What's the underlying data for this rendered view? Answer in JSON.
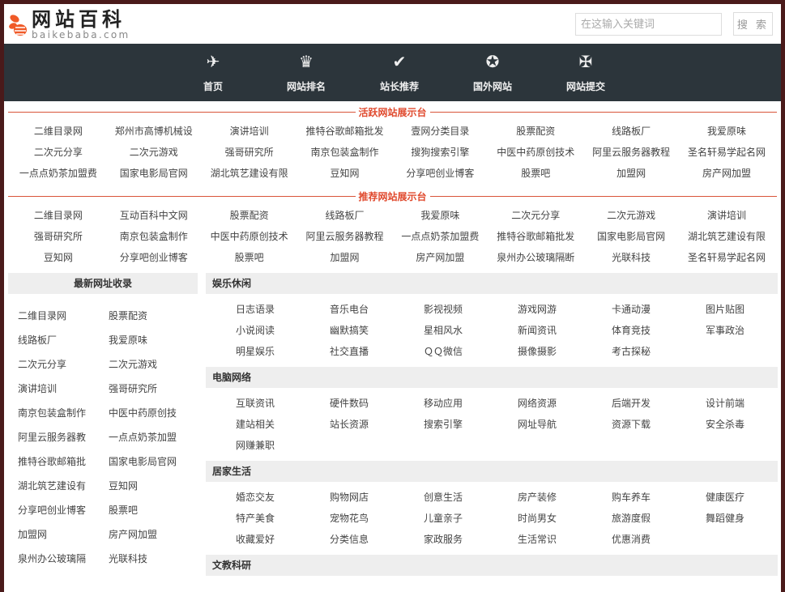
{
  "header": {
    "logo_title": "网站百科",
    "logo_sub": "baikebaba.com",
    "search_placeholder": "在这输入关键词",
    "search_button": "搜 索"
  },
  "colors": {
    "accent": "#e04a2e",
    "nav_bg": "#2c353b",
    "frame": "#4a1a1a",
    "section_bg": "#eeeeee"
  },
  "nav": [
    {
      "label": "首页",
      "icon": "plane-icon",
      "glyph": "✈"
    },
    {
      "label": "网站排名",
      "icon": "crown-icon",
      "glyph": "♛"
    },
    {
      "label": "站长推荐",
      "icon": "check-icon",
      "glyph": "✔"
    },
    {
      "label": "国外网站",
      "icon": "star-circle-icon",
      "glyph": "✪"
    },
    {
      "label": "网站提交",
      "icon": "maltese-cross-icon",
      "glyph": "✠"
    }
  ],
  "active_sites": {
    "title": "活跃网站展示台",
    "links": [
      "二维目录网",
      "郑州市高博机械设",
      "演讲培训",
      "推特谷歌邮箱批发",
      "壹网分类目录",
      "股票配资",
      "线路板厂",
      "我爱原味",
      "二次元分享",
      "二次元游戏",
      "强哥研究所",
      "南京包装盒制作",
      "搜狗搜索引擎",
      "中医中药原创技术",
      "阿里云服务器教程",
      "圣名轩易学起名网",
      "一点点奶茶加盟费",
      "国家电影局官网",
      "湖北筑艺建设有限",
      "豆知网",
      "分享吧创业博客",
      "股票吧",
      "加盟网",
      "房产网加盟"
    ]
  },
  "recommended_sites": {
    "title": "推荐网站展示台",
    "links": [
      "二维目录网",
      "互动百科中文网",
      "股票配资",
      "线路板厂",
      "我爱原味",
      "二次元分享",
      "二次元游戏",
      "演讲培训",
      "强哥研究所",
      "南京包装盒制作",
      "中医中药原创技术",
      "阿里云服务器教程",
      "一点点奶茶加盟费",
      "推特谷歌邮箱批发",
      "国家电影局官网",
      "湖北筑艺建设有限",
      "豆知网",
      "分享吧创业博客",
      "股票吧",
      "加盟网",
      "房产网加盟",
      "泉州办公玻璃隔断",
      "光联科技",
      "圣名轩易学起名网"
    ]
  },
  "latest": {
    "title": "最新网址收录",
    "links": [
      "二维目录网",
      "股票配资",
      "线路板厂",
      "我爱原味",
      "二次元分享",
      "二次元游戏",
      "演讲培训",
      "强哥研究所",
      "南京包装盒制作",
      "中医中药原创技",
      "阿里云服务器教",
      "一点点奶茶加盟",
      "推特谷歌邮箱批",
      "国家电影局官网",
      "湖北筑艺建设有",
      "豆知网",
      "分享吧创业博客",
      "股票吧",
      "加盟网",
      "房产网加盟",
      "泉州办公玻璃隔",
      "光联科技"
    ]
  },
  "categories": [
    {
      "title": "娱乐休闲",
      "links": [
        "日志语录",
        "音乐电台",
        "影视视频",
        "游戏网游",
        "卡通动漫",
        "图片贴图",
        "小说阅读",
        "幽默搞笑",
        "星相风水",
        "新闻资讯",
        "体育竞技",
        "军事政治",
        "明星娱乐",
        "社交直播",
        "ＱＱ微信",
        "摄像摄影",
        "考古探秘"
      ]
    },
    {
      "title": "电脑网络",
      "links": [
        "互联资讯",
        "硬件数码",
        "移动应用",
        "网络资源",
        "后端开发",
        "设计前端",
        "建站相关",
        "站长资源",
        "搜索引擎",
        "网址导航",
        "资源下载",
        "安全杀毒",
        "网赚兼职"
      ]
    },
    {
      "title": "居家生活",
      "links": [
        "婚恋交友",
        "购物网店",
        "创意生活",
        "房产装修",
        "购车养车",
        "健康医疗",
        "特产美食",
        "宠物花鸟",
        "儿童亲子",
        "时尚男女",
        "旅游度假",
        "舞蹈健身",
        "收藏爱好",
        "分类信息",
        "家政服务",
        "生活常识",
        "优惠消费"
      ]
    },
    {
      "title": "文教科研",
      "links": []
    }
  ]
}
